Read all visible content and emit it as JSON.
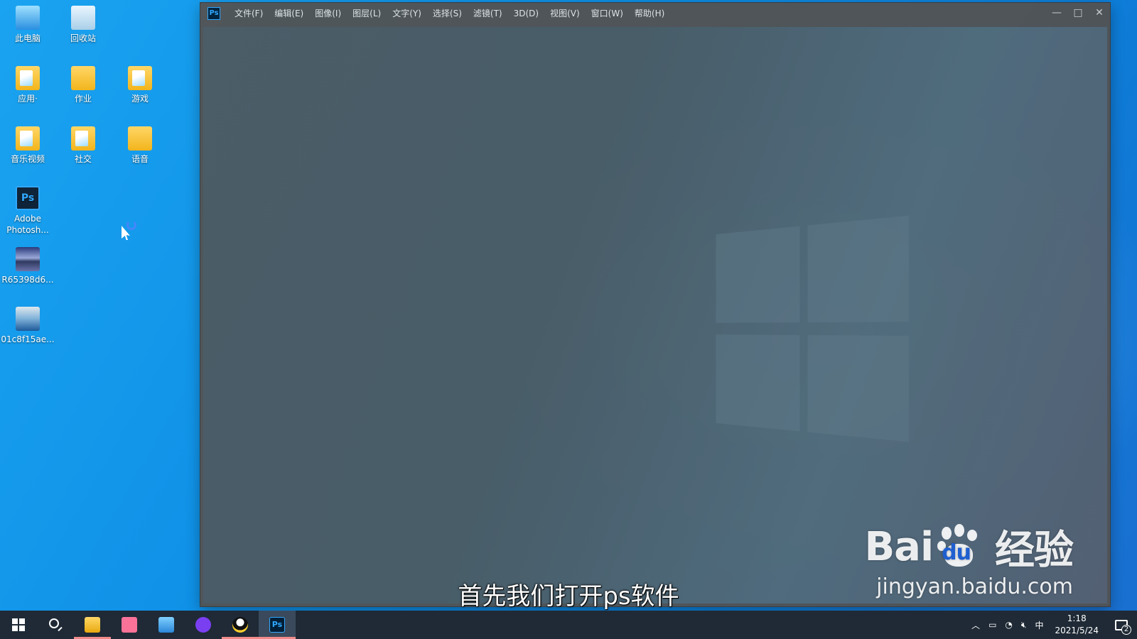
{
  "desktop": {
    "icons": [
      {
        "label": "此电脑",
        "kind": "this-pc-icon"
      },
      {
        "label": "回收站",
        "kind": "recycle-bin-icon"
      },
      {
        "label": "应用·",
        "kind": "app-folder-icon"
      },
      {
        "label": "作业",
        "kind": "folder-icon"
      },
      {
        "label": "游戏",
        "kind": "games-folder-icon"
      },
      {
        "label": "音乐视频",
        "kind": "music-video-folder-icon"
      },
      {
        "label": "社交",
        "kind": "social-folder-icon"
      },
      {
        "label": "语音",
        "kind": "folder-icon"
      },
      {
        "label": "Adobe Photosh...",
        "kind": "photoshop-shortcut-icon"
      },
      {
        "label": "R65398d6...",
        "kind": "image-file-icon"
      },
      {
        "label": "01c8f15ae...",
        "kind": "image-file-icon"
      }
    ]
  },
  "photoshop": {
    "logo": "Ps",
    "menu": [
      "文件(F)",
      "编辑(E)",
      "图像(I)",
      "图层(L)",
      "文字(Y)",
      "选择(S)",
      "滤镜(T)",
      "3D(D)",
      "视图(V)",
      "窗口(W)",
      "帮助(H)"
    ],
    "controls": {
      "minimize": "—",
      "maximize": "□",
      "close": "✕"
    }
  },
  "subtitle": "首先我们打开ps软件",
  "watermark": {
    "brand_left": "Bai",
    "brand_mid": "du",
    "brand_right": "经验",
    "url": "jingyan.baidu.com"
  },
  "taskbar": {
    "apps": [
      "start",
      "search",
      "file-explorer",
      "bilibili",
      "control-panel",
      "voice-assistant",
      "qq",
      "photoshop"
    ],
    "ps_label": "Ps",
    "tray": {
      "ime": "中",
      "time": "1:18",
      "date": "2021/5/24",
      "notifications": "2"
    }
  },
  "colors": {
    "desktop_blue": "#0e8fe6",
    "ps_bg": "#535353",
    "ps_accent": "#31a8ff",
    "taskbar": "#1f2a36"
  }
}
